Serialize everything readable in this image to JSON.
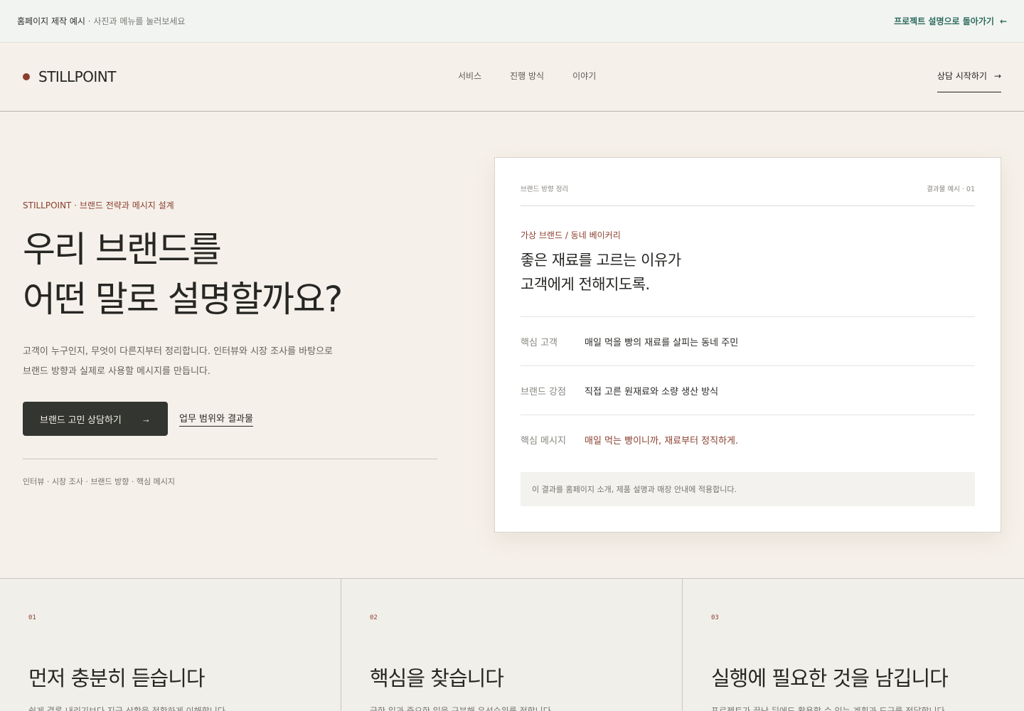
{
  "topbar": {
    "title": "홈페이지 제작 예시",
    "hint": " · 사진과 메뉴를 눌러보세요",
    "back_label": "프로젝트 설명으로 돌아가기",
    "back_icon": "←"
  },
  "header": {
    "brand": "STILLPOINT",
    "nav": [
      "서비스",
      "진행 방식",
      "이야기"
    ],
    "cta_label": "상담 시작하기",
    "cta_icon": "→"
  },
  "hero": {
    "eyebrow": "STILLPOINT · 브랜드 전략과 메시지 설계",
    "title_line1": "우리 브랜드를",
    "title_line2": "어떤 말로 설명할까요?",
    "desc_line1": "고객이 누구인지, 무엇이 다른지부터 정리합니다. 인터뷰와 시장 조사를 바탕으로",
    "desc_line2": "브랜드 방향과 실제로 사용할 메시지를 만듭니다.",
    "primary_button": "브랜드 고민 상담하기",
    "primary_icon": "→",
    "secondary_link": "업무 범위와 결과물",
    "keywords": "인터뷰 · 시장 조사 · 브랜드 방향 · 핵심 메시지"
  },
  "card": {
    "head_left": "브랜드 방향 정리",
    "head_right": "결과물 예시 · 01",
    "sub": "가상 브랜드 / 동네 베이커리",
    "title_line1": "좋은 재료를 고르는 이유가",
    "title_line2": "고객에게 전해지도록.",
    "rows": [
      {
        "label": "핵심 고객",
        "value": "매일 먹을 빵의 재료를 살피는 동네 주민"
      },
      {
        "label": "브랜드 강점",
        "value": "직접 고른 원재료와 소량 생산 방식"
      },
      {
        "label": "핵심 메시지",
        "value": "매일 먹는 빵이니까, 재료부터 정직하게."
      }
    ],
    "note": "이 결과를 홈페이지 소개, 제품 설명과 매장 안내에 적용합니다."
  },
  "features": [
    {
      "num": "01",
      "title": "먼저 충분히 듣습니다",
      "desc": "쉽게 결론 내리기보다 지금 상황을 정확하게 이해합니다."
    },
    {
      "num": "02",
      "title": "핵심을 찾습니다",
      "desc": "급한 일과 중요한 일을 구분해 우선순위를 정합니다."
    },
    {
      "num": "03",
      "title": "실행에 필요한 것을 남깁니다",
      "desc": "프로젝트가 끝난 뒤에도 활용할 수 있는 계획과 도구를 전달합니다."
    }
  ],
  "colors": {
    "accent": "#8a3f2e",
    "teal": "#2f6b5e",
    "dark": "#333531",
    "background": "#f5f0e9"
  }
}
